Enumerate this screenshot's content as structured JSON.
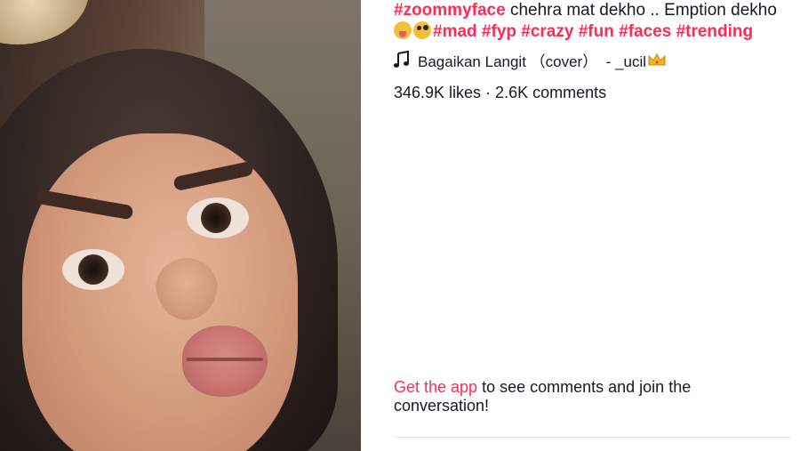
{
  "caption": {
    "line1": [
      {
        "text": "#zoommyface",
        "type": "hashtag"
      },
      {
        "text": " chehra mat dekho .. Emption dekho",
        "type": "plain"
      }
    ],
    "emojis": [
      "squinting-face-with-tongue",
      "zany-face"
    ],
    "hashtags": [
      "#mad",
      "#fyp",
      "#crazy",
      "#fun",
      "#faces",
      "#trending"
    ]
  },
  "music": {
    "icon": "music-note-icon",
    "song": "Bagaikan Langit （cover）  - _ucil",
    "trailing_icon": "crown-emoji"
  },
  "stats": {
    "text": "346.9K likes · 2.6K comments"
  },
  "cta": {
    "link_text": "Get the app",
    "rest_text": " to see comments and join the conversation!"
  },
  "colors": {
    "accent": "#fe2c55",
    "text": "#161823",
    "divider": "#e3e3e4"
  }
}
